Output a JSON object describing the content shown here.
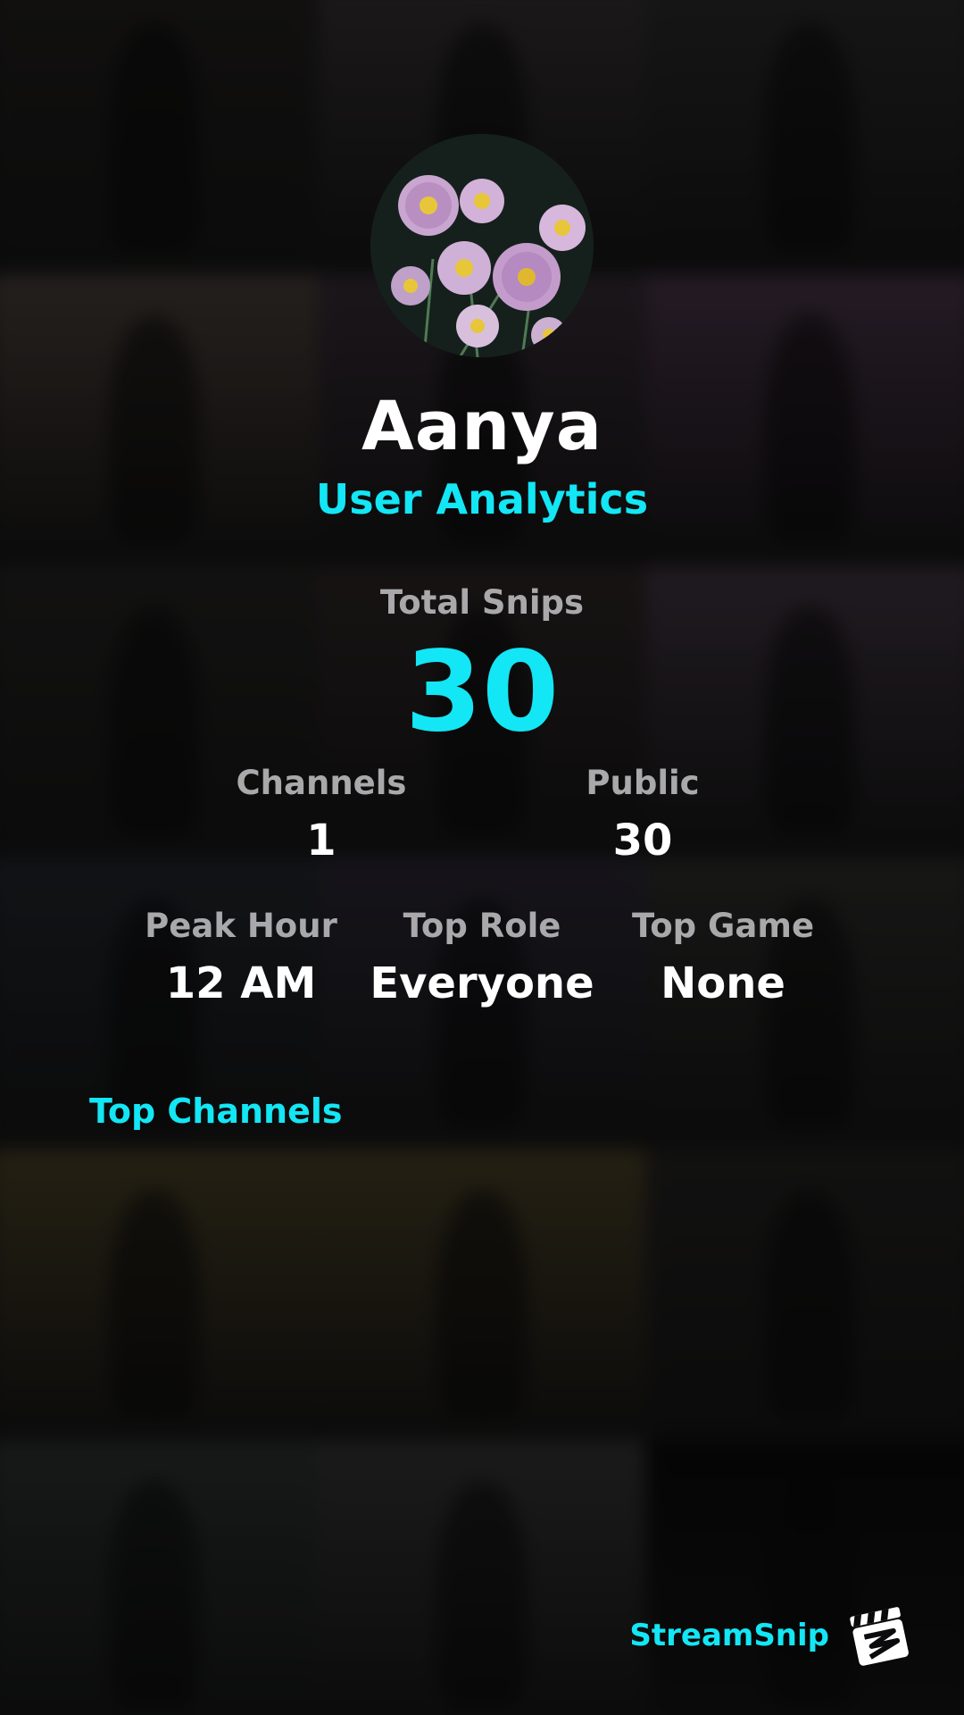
{
  "profile": {
    "username": "Aanya",
    "subtitle": "User Analytics"
  },
  "stats": {
    "total_snips_label": "Total Snips",
    "total_snips_value": "30",
    "channels_label": "Channels",
    "channels_value": "1",
    "public_label": "Public",
    "public_value": "30",
    "peak_hour_label": "Peak Hour",
    "peak_hour_value": "12 AM",
    "top_role_label": "Top Role",
    "top_role_value": "Everyone",
    "top_game_label": "Top Game",
    "top_game_value": "None"
  },
  "sections": {
    "top_channels_title": "Top Channels"
  },
  "brand": {
    "name": "StreamSnip",
    "logo_icon": "clapperboard-icon"
  },
  "colors": {
    "accent": "#13e6f5",
    "label": "#a9a9ac",
    "value": "#ffffff"
  },
  "background_tiles": [
    "#2a2624",
    "#4b4346",
    "#3c3a3a",
    "#6a5a50",
    "#4a3a48",
    "#6a4a6a",
    "#2e2c2a",
    "#3c3030",
    "#5b4a5c",
    "#28303a",
    "#3a344a",
    "#3c3c3a",
    "#6a5a30",
    "#6a5a30",
    "#2c2a28",
    "#3a4640",
    "#4a4a4a",
    "#000000"
  ]
}
